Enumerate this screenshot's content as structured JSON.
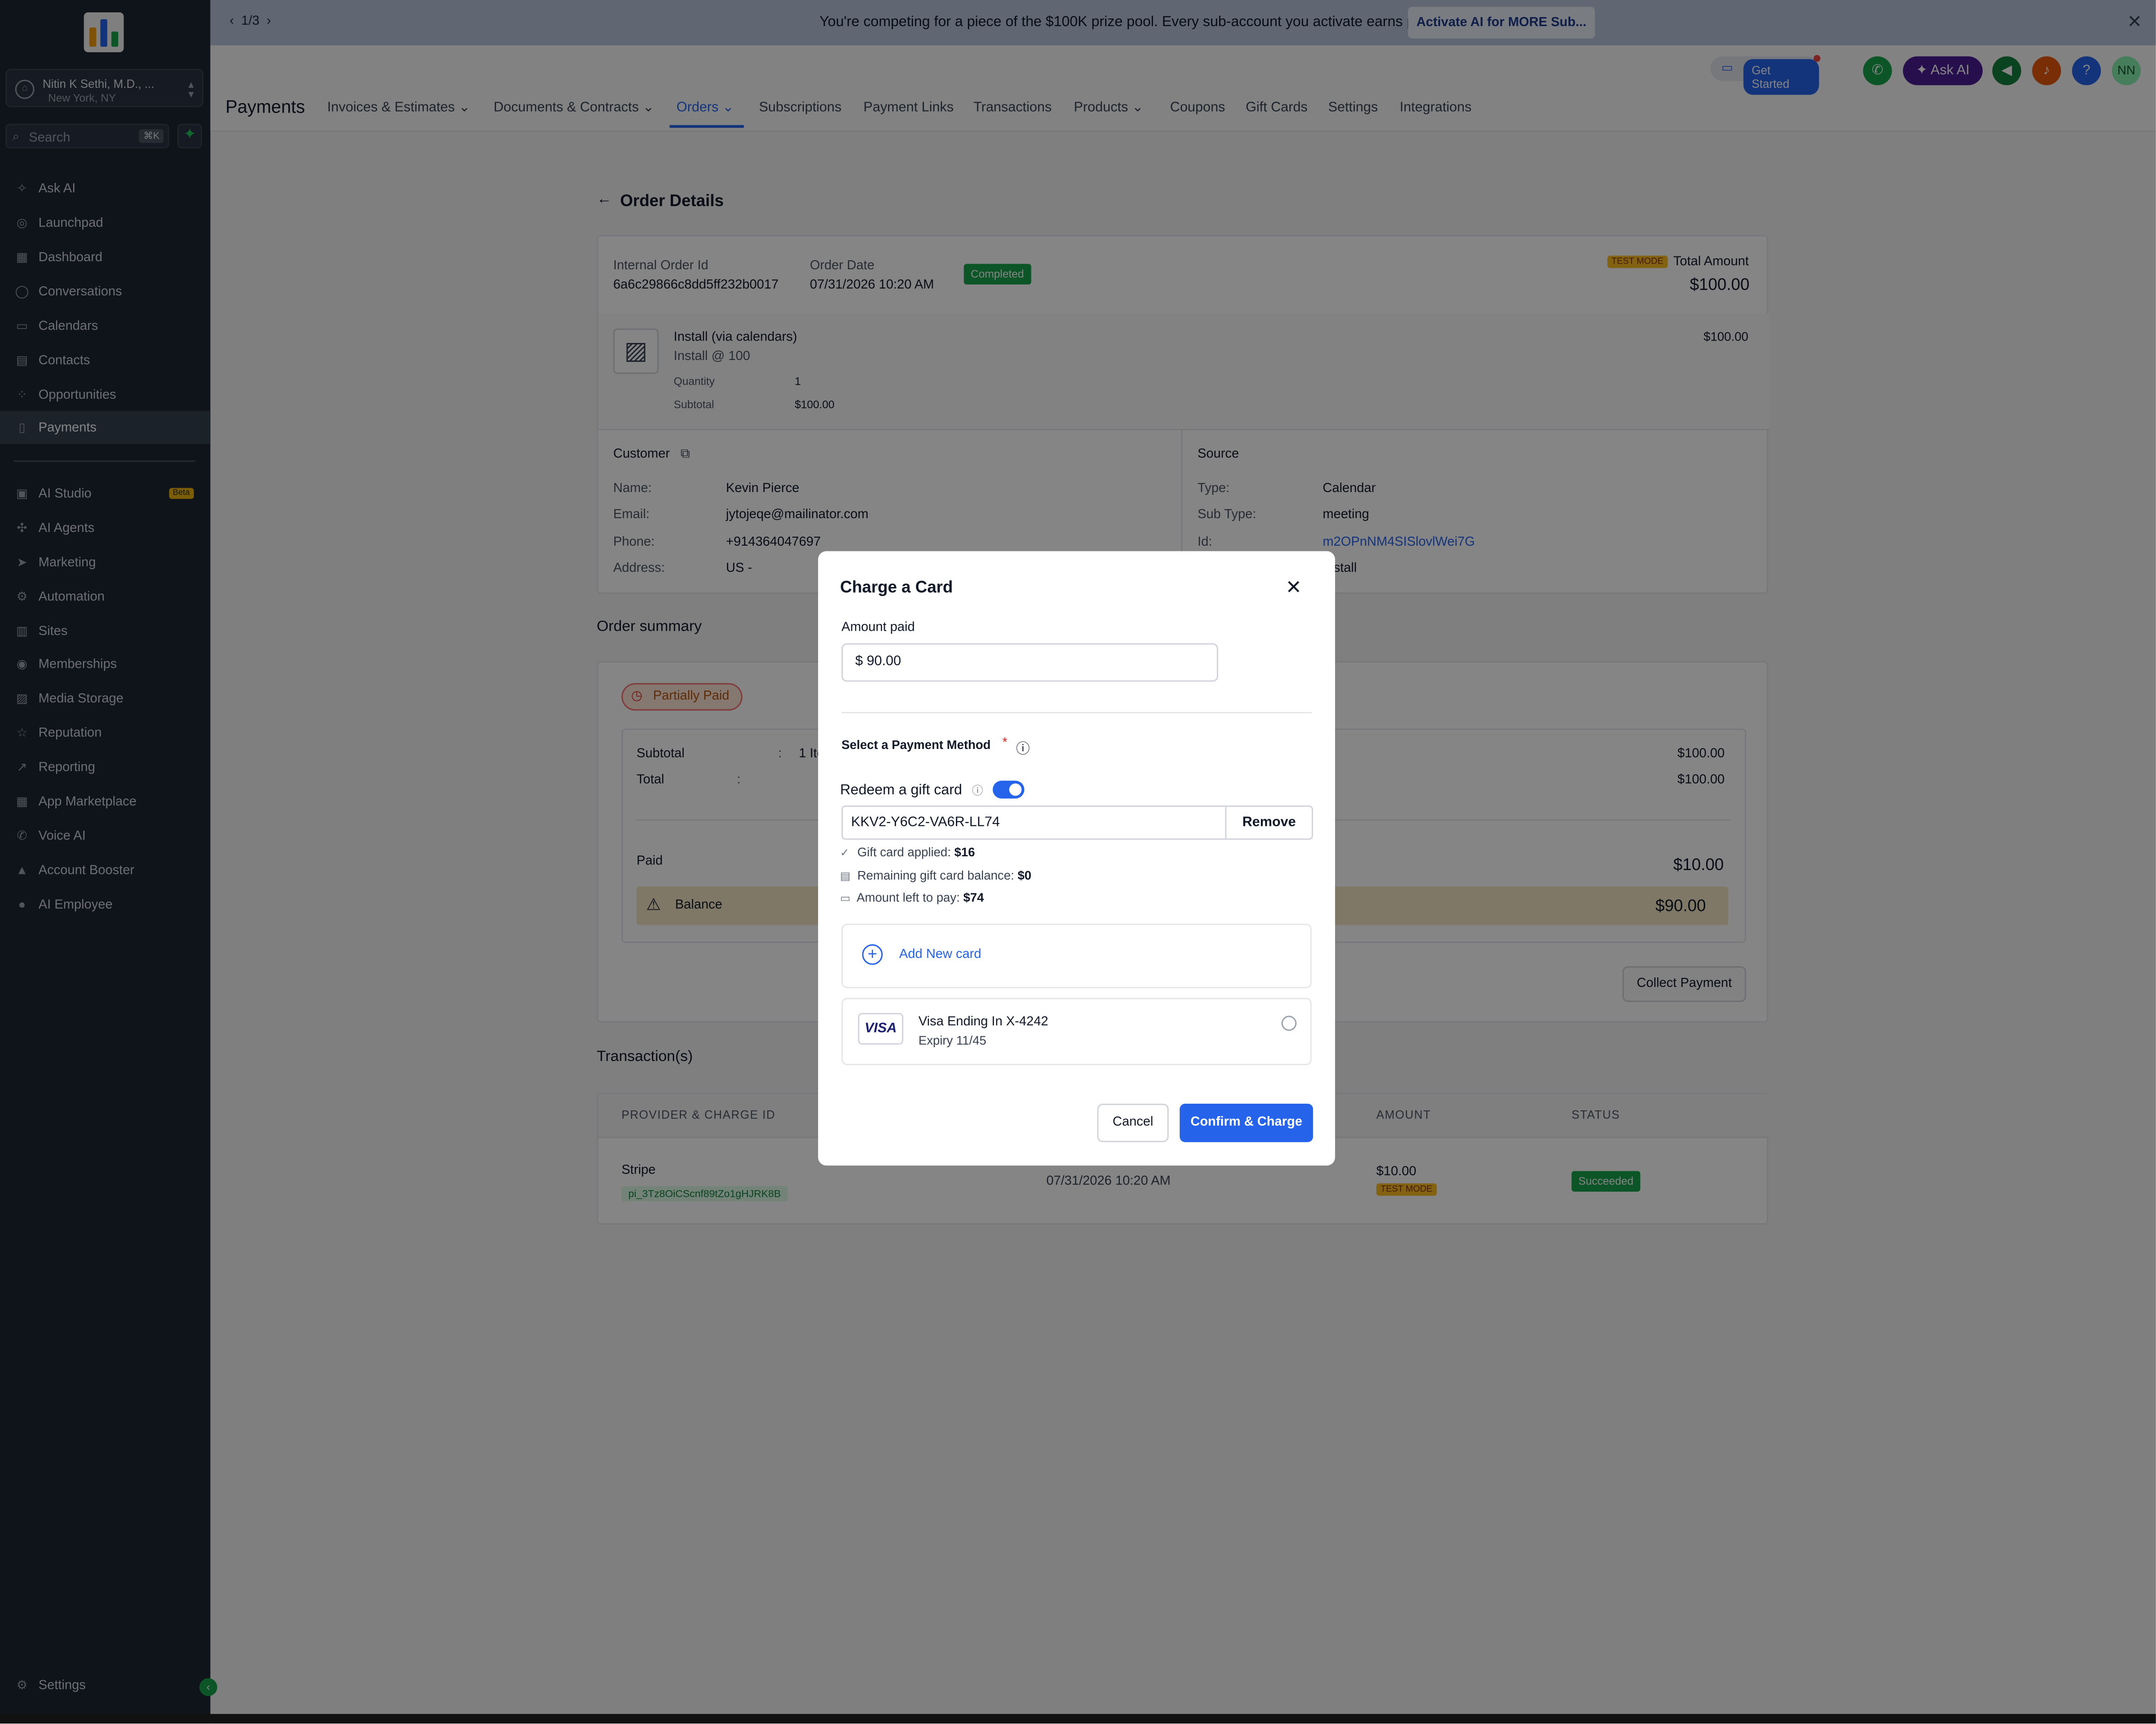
{
  "banner": {
    "pager": "1/3",
    "message": "You're competing for a piece of the $100K prize pool. Every sub-account you activate earns points.",
    "action": "Activate AI for MORE Sub..."
  },
  "sidebar": {
    "account_name": "Nitin K Sethi, M.D., ...",
    "account_location": "New York, NY",
    "search_placeholder": "Search",
    "search_shortcut": "⌘K",
    "items": [
      {
        "label": "Ask AI",
        "icon": "sparkle-icon"
      },
      {
        "label": "Launchpad",
        "icon": "rocket-icon"
      },
      {
        "label": "Dashboard",
        "icon": "grid-icon"
      },
      {
        "label": "Conversations",
        "icon": "chat-icon"
      },
      {
        "label": "Calendars",
        "icon": "calendar-icon"
      },
      {
        "label": "Contacts",
        "icon": "contacts-icon"
      },
      {
        "label": "Opportunities",
        "icon": "funnel-icon"
      },
      {
        "label": "Payments",
        "icon": "receipt-icon"
      }
    ],
    "items2": [
      {
        "label": "AI Studio",
        "icon": "ai-studio-icon",
        "badge": "Beta"
      },
      {
        "label": "AI Agents",
        "icon": "agent-icon"
      },
      {
        "label": "Marketing",
        "icon": "send-icon"
      },
      {
        "label": "Automation",
        "icon": "automation-icon"
      },
      {
        "label": "Sites",
        "icon": "sites-icon"
      },
      {
        "label": "Memberships",
        "icon": "membership-icon"
      },
      {
        "label": "Media Storage",
        "icon": "image-icon"
      },
      {
        "label": "Reputation",
        "icon": "star-icon"
      },
      {
        "label": "Reporting",
        "icon": "chart-icon"
      },
      {
        "label": "App Marketplace",
        "icon": "apps-icon"
      },
      {
        "label": "Voice AI",
        "icon": "phone-icon"
      },
      {
        "label": "Account Booster",
        "icon": "booster-icon"
      },
      {
        "label": "AI Employee",
        "icon": "person-icon"
      }
    ],
    "settings_label": "Settings"
  },
  "topbar": {
    "title": "Payments",
    "get_started": "Get Started",
    "ask_ai": "Ask AI",
    "avatar_initials": "NN",
    "tabs": [
      {
        "label": "Invoices & Estimates"
      },
      {
        "label": "Documents & Contracts"
      },
      {
        "label": "Orders"
      },
      {
        "label": "Subscriptions"
      },
      {
        "label": "Payment Links"
      },
      {
        "label": "Transactions"
      },
      {
        "label": "Products"
      },
      {
        "label": "Coupons"
      },
      {
        "label": "Gift Cards"
      },
      {
        "label": "Settings"
      },
      {
        "label": "Integrations"
      }
    ]
  },
  "order": {
    "page_title": "Order Details",
    "internal_id_label": "Internal Order Id",
    "internal_id": "6a6c29866c8dd5ff232b0017",
    "date_label": "Order Date",
    "date": "07/31/2026 10:20 AM",
    "status": "Completed",
    "test_mode": "TEST MODE",
    "total_label": "Total Amount",
    "total": "$100.00",
    "item": {
      "name": "Install (via calendars)",
      "sub": "Install @ 100",
      "price": "$100.00",
      "quantity_label": "Quantity",
      "quantity": "1",
      "subtotal_label": "Subtotal",
      "subtotal": "$100.00"
    },
    "customer": {
      "title": "Customer",
      "name_label": "Name:",
      "name": "Kevin Pierce",
      "email_label": "Email:",
      "email": "jytojeqe@mailinator.com",
      "phone_label": "Phone:",
      "phone": "+914364047697",
      "address_label": "Address:",
      "address": "US -"
    },
    "source": {
      "title": "Source",
      "type_label": "Type:",
      "type": "Calendar",
      "subtype_label": "Sub Type:",
      "subtype": "meeting",
      "id_label": "Id:",
      "id": "m2OPnNM4SISlovlWei7G",
      "name": "Install"
    }
  },
  "summary": {
    "title": "Order summary",
    "status": "Partially Paid",
    "subtotal_label": "Subtotal",
    "colon": ":",
    "subtotal_items": "1 Ite",
    "subtotal": "$100.00",
    "total_label": "Total",
    "total": "$100.00",
    "paid_label": "Paid",
    "paid": "$10.00",
    "balance_label": "Balance",
    "balance": "$90.00",
    "collect_button": "Collect Payment"
  },
  "transactions": {
    "title": "Transaction(s)",
    "headers": [
      "PROVIDER & CHARGE ID",
      "AMOUNT",
      "STATUS"
    ],
    "rows": [
      {
        "provider": "Stripe",
        "charge_id": "pi_3Tz8OiCScnf89tZo1gHJRK8B",
        "date": "07/31/2026 10:20 AM",
        "amount": "$10.00",
        "mode": "TEST MODE",
        "status": "Succeeded"
      }
    ]
  },
  "modal": {
    "title": "Charge a Card",
    "amount_label": "Amount paid",
    "amount_value": "$ 90.00",
    "payment_method_label": "Select a Payment Method",
    "required_mark": "*",
    "gift_label": "Redeem a gift card",
    "gift_code": "KKV2-Y6C2-VA6R-LL74",
    "remove_label": "Remove",
    "applied_label": "Gift card applied:",
    "applied_value": "$16",
    "remaining_label": "Remaining gift card balance:",
    "remaining_value": "$0",
    "left_label": "Amount left to pay:",
    "left_value": "$74",
    "add_card": "Add New card",
    "visa_brand": "VISA",
    "card_name": "Visa Ending In X-4242",
    "card_expiry": "Expiry 11/45",
    "cancel": "Cancel",
    "confirm": "Confirm & Charge"
  }
}
